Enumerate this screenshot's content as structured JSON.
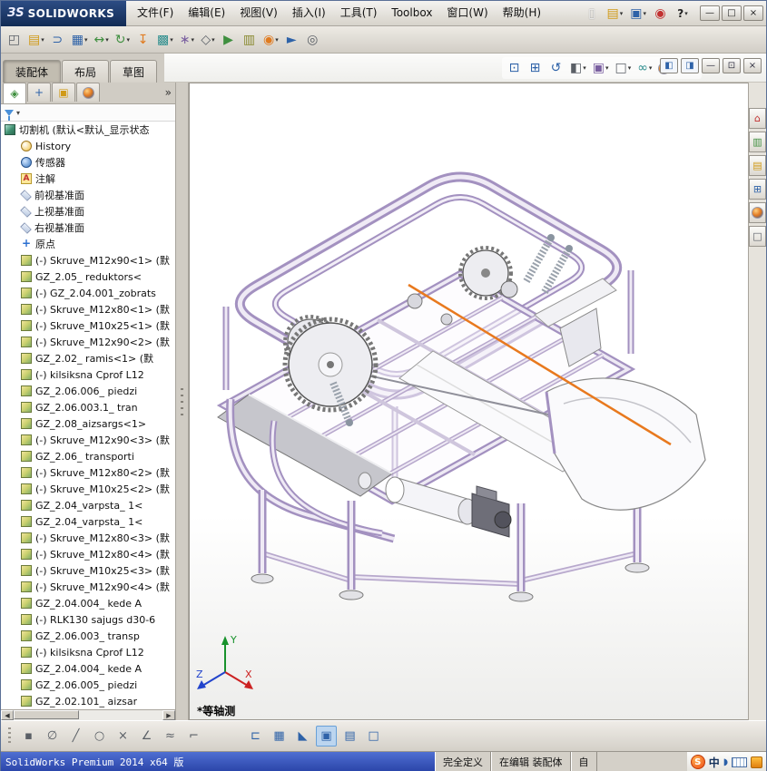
{
  "theme": {
    "frame_lavender": "#a391c0",
    "highlight_orange": "#e8791e",
    "titlebar_blue": "#122b54",
    "statusbar_blue": "#2a44a8"
  },
  "titlebar": {
    "logo_text": "ЗS",
    "brand": "SOLIDWORKS",
    "menus": [
      "文件(F)",
      "编辑(E)",
      "视图(V)",
      "插入(I)",
      "工具(T)",
      "Toolbox",
      "窗口(W)",
      "帮助(H)"
    ],
    "qat": [
      {
        "name": "new-document-button",
        "glyph": "▯",
        "tone": "light",
        "caret": ""
      },
      {
        "name": "open-button",
        "glyph": "▤",
        "tone": "yellow",
        "caret": "▾"
      },
      {
        "name": "save-button",
        "glyph": "▣",
        "tone": "blue",
        "caret": "▾"
      },
      {
        "name": "rebuild-button",
        "glyph": "◉",
        "tone": "red",
        "caret": ""
      },
      {
        "name": "help-button",
        "glyph": "?",
        "tone": "dark",
        "caret": "▾"
      }
    ],
    "window_controls": {
      "minimize": "—",
      "maximize": "□",
      "close": "×"
    }
  },
  "toolbar": [
    {
      "name": "insert-component-button",
      "glyph": "◰",
      "tone": "gray",
      "caret": ""
    },
    {
      "name": "open-part-button",
      "glyph": "▤",
      "tone": "yellow",
      "caret": "▾"
    },
    {
      "name": "mate-button",
      "glyph": "⊃",
      "tone": "blue",
      "caret": ""
    },
    {
      "name": "linear-component-pattern-button",
      "glyph": "▦",
      "tone": "blue",
      "caret": "▾"
    },
    {
      "name": "move-component-button",
      "glyph": "↔",
      "tone": "green",
      "caret": "▾"
    },
    {
      "name": "rotate-component-button",
      "glyph": "↻",
      "tone": "green",
      "caret": "▾"
    },
    {
      "name": "smart-fasteners-button",
      "glyph": "↧",
      "tone": "orange",
      "caret": ""
    },
    {
      "name": "component-pattern-button",
      "glyph": "▩",
      "tone": "teal",
      "caret": "▾"
    },
    {
      "name": "assembly-features-button",
      "glyph": "∗",
      "tone": "purple",
      "caret": "▾"
    },
    {
      "name": "reference-geometry-button",
      "glyph": "◇",
      "tone": "gray",
      "caret": "▾"
    },
    {
      "name": "new-motion-study-button",
      "glyph": "▶",
      "tone": "green",
      "caret": ""
    },
    {
      "name": "bill-of-materials-button",
      "glyph": "▥",
      "tone": "olive",
      "caret": ""
    },
    {
      "name": "exploded-view-button",
      "glyph": "◉",
      "tone": "orange",
      "caret": "▾"
    },
    {
      "name": "instant3d-button",
      "glyph": "►",
      "tone": "blue",
      "caret": ""
    },
    {
      "name": "options-button",
      "glyph": "◎",
      "tone": "gray",
      "caret": ""
    }
  ],
  "tabs": [
    "装配体",
    "布局",
    "草图"
  ],
  "headsup": [
    {
      "name": "zoom-fit-button",
      "glyph": "⊡",
      "tone": "blue",
      "caret": ""
    },
    {
      "name": "zoom-area-button",
      "glyph": "⊞",
      "tone": "blue",
      "caret": ""
    },
    {
      "name": "previous-view-button",
      "glyph": "↺",
      "tone": "blue",
      "caret": ""
    },
    {
      "name": "section-view-button",
      "glyph": "◧",
      "tone": "gray",
      "caret": "▾"
    },
    {
      "name": "view-orientation-button",
      "glyph": "▣",
      "tone": "purple",
      "caret": "▾"
    },
    {
      "name": "display-style-button",
      "glyph": "□",
      "tone": "gray",
      "caret": "▾"
    },
    {
      "name": "hide-show-items-button",
      "glyph": "∞",
      "tone": "teal",
      "caret": "▾"
    },
    {
      "name": "edit-appearance-button",
      "glyph": "",
      "tone": "ball",
      "caret": "▾"
    },
    {
      "name": "view-settings-button",
      "glyph": "◑",
      "tone": "orange",
      "caret": "▾"
    }
  ],
  "docctl": {
    "left_pane": "◧",
    "right_pane": "◨",
    "minimize": "—",
    "restore": "⊡",
    "close": "×"
  },
  "panel": {
    "tabs": [
      {
        "name": "featuremanager-tab",
        "glyph": "◈",
        "tone": "green"
      },
      {
        "name": "propertymanager-tab",
        "glyph": "+",
        "tone": "blue"
      },
      {
        "name": "configurationmanager-tab",
        "glyph": "▣",
        "tone": "yellow"
      },
      {
        "name": "displaymanager-tab",
        "glyph": "",
        "tone": "ball"
      }
    ],
    "more_glyph": "»",
    "filter_caret": "▾",
    "scroll_left": "◀",
    "scroll_right": "▶"
  },
  "tree": {
    "root": "切割机 (默认<默认_显示状态",
    "history": "History",
    "sensors": "传感器",
    "annotations": "注解",
    "ann_glyph": "A",
    "plane_front": "前视基准面",
    "plane_top": "上视基准面",
    "plane_right": "右视基准面",
    "origin": "原点",
    "origin_glyph": "+",
    "components": [
      "(-) Skruve_M12x90<1> (默",
      "GZ_2.05_ reduktors<",
      "(-) GZ_2.04.001_zobrats",
      "(-) Skruve_M12x80<1> (默",
      "(-) Skruve_M10x25<1> (默",
      "(-) Skruve_M12x90<2> (默",
      "GZ_2.02_ ramis<1> (默",
      "(-) kilsiksna Cprof L12",
      "GZ_2.06.006_ piedzi",
      "GZ_2.06.003.1_ tran",
      "GZ_2.08_aizsargs<1>",
      "(-) Skruve_M12x90<3> (默",
      "GZ_2.06_ transporti",
      "(-) Skruve_M12x80<2> (默",
      "(-) Skruve_M10x25<2> (默",
      "GZ_2.04_varpsta_ 1<",
      "GZ_2.04_varpsta_ 1<",
      "(-) Skruve_M12x80<3> (默",
      "(-) Skruve_M12x80<4> (默",
      "(-) Skruve_M10x25<3> (默",
      "(-) Skruve_M12x90<4> (默",
      "GZ_2.04.004_ kede A",
      "(-) RLK130 sajugs d30-6",
      "GZ_2.06.003_ transp",
      "(-) kilsiksna Cprof L12",
      "GZ_2.04.004_ kede A",
      "GZ_2.06.005_ piedzi",
      "GZ_2.02.101_ aizsar"
    ]
  },
  "viewport": {
    "view_label": "*等轴测",
    "triad_x": "X",
    "triad_y": "Y",
    "triad_z": "Z"
  },
  "taskpane": [
    {
      "name": "solidworks-resources-tab",
      "glyph": "⌂",
      "tone": "red"
    },
    {
      "name": "design-library-tab",
      "glyph": "▥",
      "tone": "green"
    },
    {
      "name": "file-explorer-tab",
      "glyph": "▤",
      "tone": "yellow"
    },
    {
      "name": "view-palette-tab",
      "glyph": "⊞",
      "tone": "blue"
    },
    {
      "name": "appearances-scenes-tab",
      "glyph": "",
      "tone": "ball"
    },
    {
      "name": "custom-properties-tab",
      "glyph": "□",
      "tone": "gray"
    }
  ],
  "sketchbar": [
    {
      "name": "sketch-point-tool",
      "glyph": "▪",
      "tone": "gray"
    },
    {
      "name": "sketch-slot-tool",
      "glyph": "∅",
      "tone": "gray"
    },
    {
      "name": "sketch-line-tool",
      "glyph": "╱",
      "tone": "gray"
    },
    {
      "name": "sketch-circle-tool",
      "glyph": "○",
      "tone": "gray"
    },
    {
      "name": "sketch-trim-tool",
      "glyph": "×",
      "tone": "gray"
    },
    {
      "name": "sketch-angle-tool",
      "glyph": "∠",
      "tone": "gray"
    },
    {
      "name": "sketch-spline-tool",
      "glyph": "≈",
      "tone": "gray"
    },
    {
      "name": "sketch-corner-tool",
      "glyph": "⌐",
      "tone": "gray"
    },
    {
      "name": "view-pan-tool",
      "glyph": "⊏",
      "tone": "blue"
    },
    {
      "name": "view-grid-tool",
      "glyph": "▦",
      "tone": "blue"
    },
    {
      "name": "view-triangle-tool",
      "glyph": "◣",
      "tone": "blue"
    },
    {
      "name": "view-section-tool",
      "glyph": "▣",
      "tone": "blue"
    },
    {
      "name": "view-list-tool",
      "glyph": "▤",
      "tone": "blue"
    },
    {
      "name": "view-box-tool",
      "glyph": "□",
      "tone": "blue"
    }
  ],
  "statusbar": {
    "left": "SolidWorks Premium 2014 x64 版",
    "define_state": "完全定义",
    "editing": "在编辑 装配体",
    "custom": "自",
    "ime": {
      "sogou": "S",
      "lang": "中",
      "tool": "◗"
    }
  }
}
